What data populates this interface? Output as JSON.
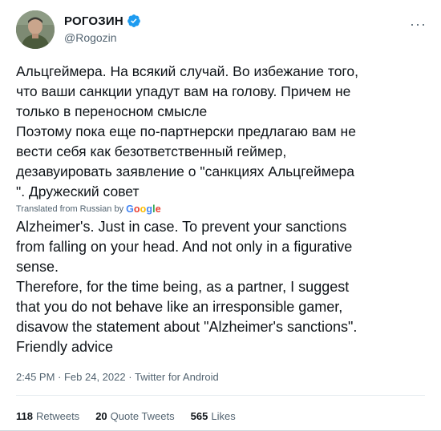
{
  "header": {
    "display_name": "РОГОЗИН",
    "handle": "@Rogozin",
    "more_label": "···"
  },
  "tweet": {
    "original_text": "Альцгеймера. На всякий случай. Во избежание того,\nчто ваши санкции упадут вам на голову. Причем не\nтолько в переносном смысле\nПоэтому пока еще по-партнерски предлагаю вам не\nвести себя как безответственный геймер,\nдезавуировать заявление о \"санкциях Альцгеймера\n\". Дружеский совет",
    "translated_from": "Translated from Russian by",
    "google_letters": [
      "G",
      "o",
      "o",
      "g",
      "l",
      "e"
    ],
    "translated_text": "Alzheimer's. Just in case. To prevent your sanctions\nfrom falling on your head. And not only in a figurative\nsense.\n Therefore, for the time being, as a partner, I suggest\nthat you do not behave like an irresponsible gamer,\ndisavow the statement about \"Alzheimer's sanctions\".\nFriendly advice"
  },
  "meta": {
    "time": "2:45 PM",
    "separator": " · ",
    "date": "Feb 24, 2022",
    "source": "Twitter for Android"
  },
  "stats": {
    "retweets_count": "118",
    "retweets_label": "Retweets",
    "quotes_count": "20",
    "quotes_label": "Quote Tweets",
    "likes_count": "565",
    "likes_label": "Likes"
  },
  "colors": {
    "verified_blue": "#1d9bf0",
    "secondary_text": "#536471"
  }
}
